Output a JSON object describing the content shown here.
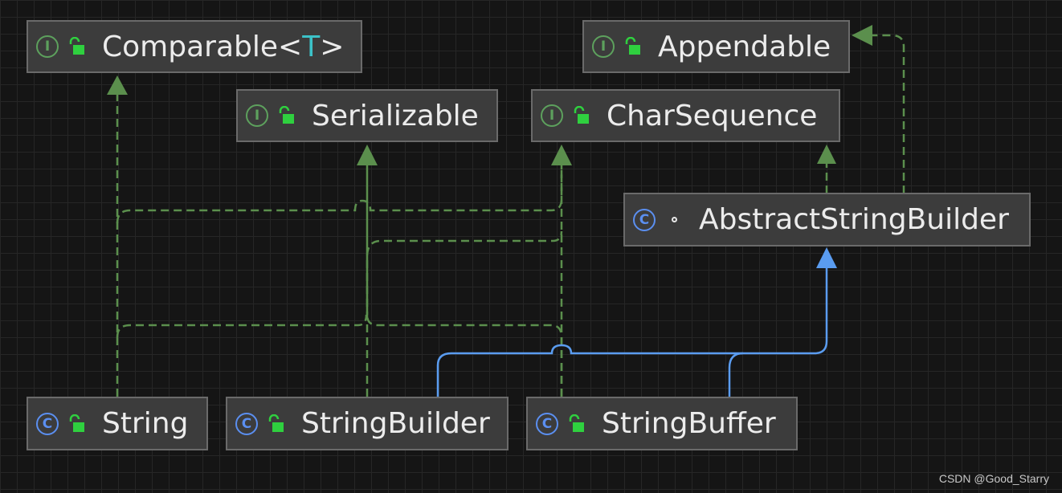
{
  "nodes": {
    "comparable": {
      "name": "Comparable",
      "open": "<",
      "type_param": "T",
      "close": ">",
      "kind_icon": "I",
      "kind": "interface",
      "visibility": "public"
    },
    "appendable": {
      "name": "Appendable",
      "kind_icon": "I",
      "kind": "interface",
      "visibility": "public"
    },
    "serializable": {
      "name": "Serializable",
      "kind_icon": "I",
      "kind": "interface",
      "visibility": "public"
    },
    "charsequence": {
      "name": "CharSequence",
      "kind_icon": "I",
      "kind": "interface",
      "visibility": "public"
    },
    "abstractstringbuilder": {
      "name": "AbstractStringBuilder",
      "kind_icon": "C",
      "kind": "class",
      "visibility": "package-private"
    },
    "string": {
      "name": "String",
      "kind_icon": "C",
      "kind": "class",
      "visibility": "public"
    },
    "stringbuilder": {
      "name": "StringBuilder",
      "kind_icon": "C",
      "kind": "class",
      "visibility": "public"
    },
    "stringbuffer": {
      "name": "StringBuffer",
      "kind_icon": "C",
      "kind": "class",
      "visibility": "public"
    }
  },
  "relations": [
    {
      "from": "String",
      "to": "Comparable",
      "type": "implements"
    },
    {
      "from": "String",
      "to": "Serializable",
      "type": "implements"
    },
    {
      "from": "String",
      "to": "CharSequence",
      "type": "implements"
    },
    {
      "from": "StringBuilder",
      "to": "Serializable",
      "type": "implements"
    },
    {
      "from": "StringBuilder",
      "to": "CharSequence",
      "type": "implements"
    },
    {
      "from": "StringBuffer",
      "to": "Serializable",
      "type": "implements"
    },
    {
      "from": "StringBuffer",
      "to": "CharSequence",
      "type": "implements"
    },
    {
      "from": "AbstractStringBuilder",
      "to": "CharSequence",
      "type": "implements"
    },
    {
      "from": "AbstractStringBuilder",
      "to": "Appendable",
      "type": "implements"
    },
    {
      "from": "StringBuilder",
      "to": "AbstractStringBuilder",
      "type": "extends"
    },
    {
      "from": "StringBuffer",
      "to": "AbstractStringBuilder",
      "type": "extends"
    }
  ],
  "colors": {
    "background": "#151515",
    "node_fill": "#3c3c3c",
    "node_border": "#6a6a6a",
    "implements_edge": "#5b8f4d",
    "extends_edge": "#5a9cf0",
    "interface_icon": "#5da15d",
    "class_icon": "#5b8ff0",
    "public_lock": "#2fd03f",
    "type_param": "#3cc2c8"
  },
  "watermark": "CSDN @Good_Starry"
}
